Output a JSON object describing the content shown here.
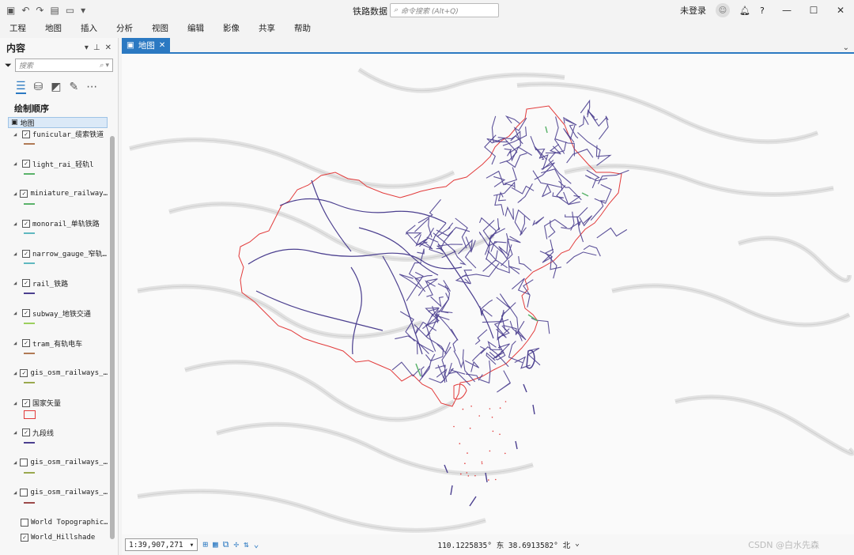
{
  "title_bar": {
    "document_title": "铁路数据",
    "search_placeholder": "命令搜索 (Alt+Q)",
    "user_label": "未登录",
    "help_label": "?"
  },
  "menu": [
    "工程",
    "地图",
    "插入",
    "分析",
    "视图",
    "编辑",
    "影像",
    "共享",
    "帮助"
  ],
  "contents_pane": {
    "title": "内容",
    "search_placeholder": "搜索",
    "section_label": "绘制顺序",
    "map_node": "地图",
    "layers": [
      {
        "name": "funicular_缆索铁道",
        "checked": true,
        "color": "#b07a55",
        "kind": "line"
      },
      {
        "name": "light_rai_轻轨l",
        "checked": true,
        "color": "#5ab36a",
        "kind": "line"
      },
      {
        "name": "miniature_railway…",
        "checked": true,
        "color": "#5ab36a",
        "kind": "line"
      },
      {
        "name": "monorail_单轨铁路",
        "checked": true,
        "color": "#5fb8c0",
        "kind": "line"
      },
      {
        "name": "narrow_gauge_窄轨…",
        "checked": true,
        "color": "#5fb8c0",
        "kind": "line"
      },
      {
        "name": "rail_铁路",
        "checked": true,
        "color": "#4b3f8f",
        "kind": "line"
      },
      {
        "name": "subway_地铁交通",
        "checked": true,
        "color": "#9ccf5e",
        "kind": "line"
      },
      {
        "name": "tram_有轨电车",
        "checked": true,
        "color": "#b07a55",
        "kind": "line"
      },
      {
        "name": "gis_osm_railways_…",
        "checked": true,
        "color": "#9aa84e",
        "kind": "line"
      },
      {
        "name": "国家矢量",
        "checked": true,
        "color": "#e23b3b",
        "kind": "polygon"
      },
      {
        "name": "九段线",
        "checked": true,
        "color": "#4b3f8f",
        "kind": "line"
      },
      {
        "name": "gis_osm_railways_…",
        "checked": false,
        "color": "#9aa84e",
        "kind": "line"
      },
      {
        "name": "gis_osm_railways_…",
        "checked": false,
        "color": "#9c4a4a",
        "kind": "line"
      }
    ],
    "basemaps": [
      {
        "name": "World Topographic…",
        "checked": false
      },
      {
        "name": "World_Hillshade",
        "checked": true
      }
    ]
  },
  "map_view": {
    "tab_label": "地图",
    "scale": "1:39,907,271",
    "coordinates": "110.1225835° 东 38.6913582° 北",
    "watermark": "CSDN @白水先森"
  },
  "colors": {
    "accent": "#2b79c2",
    "boundary": "#e23b3b",
    "rail": "#4b3f8f"
  }
}
